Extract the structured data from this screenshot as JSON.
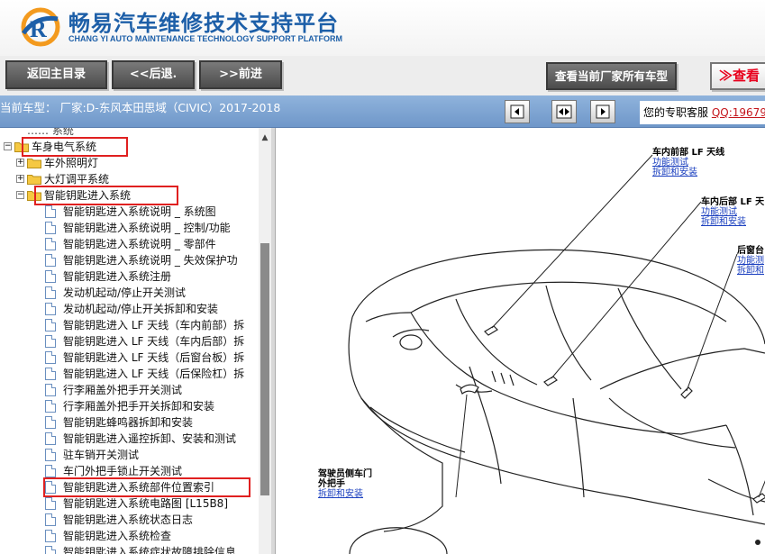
{
  "header": {
    "title": "畅易汽车维修技术支持平台",
    "subtitle": "CHANG YI AUTO MAINTENANCE TECHNOLOGY SUPPORT PLATFORM"
  },
  "toolbar": {
    "home_label": "返回主目录",
    "back_label": "<<后退.",
    "forward_label": ">>前进",
    "all_models_label": "查看当前厂家所有车型",
    "view_label": "≫查看"
  },
  "infobar": {
    "current_model": "当前车型：  厂家:D-东风本田思域（CIVIC）2017-2018",
    "support_text": "您的专职客服",
    "support_link": "QQ:19679"
  },
  "tree": {
    "top_partial": "…… 系统",
    "items": [
      {
        "label": "车身电气系统",
        "level": 0,
        "kind": "folder",
        "expanded": true,
        "highlight": true
      },
      {
        "label": "车外照明灯",
        "level": 1,
        "kind": "folder",
        "expanded": false
      },
      {
        "label": "大灯调平系统",
        "level": 1,
        "kind": "folder",
        "expanded": false
      },
      {
        "label": "智能钥匙进入系统",
        "level": 1,
        "kind": "folder",
        "expanded": true,
        "highlight": true
      },
      {
        "label": "智能钥匙进入系统说明 _ 系统图",
        "level": 2,
        "kind": "doc"
      },
      {
        "label": "智能钥匙进入系统说明 _ 控制/功能",
        "level": 2,
        "kind": "doc"
      },
      {
        "label": "智能钥匙进入系统说明 _ 零部件",
        "level": 2,
        "kind": "doc"
      },
      {
        "label": "智能钥匙进入系统说明 _ 失效保护功",
        "level": 2,
        "kind": "doc"
      },
      {
        "label": "智能钥匙进入系统注册",
        "level": 2,
        "kind": "doc"
      },
      {
        "label": "发动机起动/停止开关测试",
        "level": 2,
        "kind": "doc"
      },
      {
        "label": "发动机起动/停止开关拆卸和安装",
        "level": 2,
        "kind": "doc"
      },
      {
        "label": "智能钥匙进入 LF 天线（车内前部）拆",
        "level": 2,
        "kind": "doc"
      },
      {
        "label": "智能钥匙进入 LF 天线（车内后部）拆",
        "level": 2,
        "kind": "doc"
      },
      {
        "label": "智能钥匙进入 LF 天线（后窗台板）拆",
        "level": 2,
        "kind": "doc"
      },
      {
        "label": "智能钥匙进入 LF 天线（后保险杠）拆",
        "level": 2,
        "kind": "doc"
      },
      {
        "label": "行李厢盖外把手开关测试",
        "level": 2,
        "kind": "doc"
      },
      {
        "label": "行李厢盖外把手开关拆卸和安装",
        "level": 2,
        "kind": "doc"
      },
      {
        "label": "智能钥匙蜂鸣器拆卸和安装",
        "level": 2,
        "kind": "doc"
      },
      {
        "label": "智能钥匙进入遥控拆卸、安装和测试",
        "level": 2,
        "kind": "doc"
      },
      {
        "label": "驻车销开关测试",
        "level": 2,
        "kind": "doc"
      },
      {
        "label": "车门外把手锁止开关测试",
        "level": 2,
        "kind": "doc"
      },
      {
        "label": "智能钥匙进入系统部件位置索引",
        "level": 2,
        "kind": "doc",
        "highlight": true
      },
      {
        "label": "智能钥匙进入系统电路图 [L15B8]",
        "level": 2,
        "kind": "doc"
      },
      {
        "label": "智能钥匙进入系统状态日志",
        "level": 2,
        "kind": "doc"
      },
      {
        "label": "智能钥匙进入系统检查",
        "level": 2,
        "kind": "doc"
      },
      {
        "label": "智能钥匙进入系统症状故障排除信息",
        "level": 2,
        "kind": "doc"
      }
    ]
  },
  "diagram": {
    "callouts": [
      {
        "title": "车内前部 LF 天线",
        "links": [
          "功能测试",
          "拆卸和安装"
        ]
      },
      {
        "title": "车内后部 LF 天",
        "links": [
          "功能测试",
          "拆卸和安装"
        ]
      },
      {
        "title": "后窗台",
        "links": [
          "功能测",
          "拆卸和"
        ]
      },
      {
        "title": "驾驶员侧车门",
        "title2": "外把手",
        "links": [
          "拆卸和安装"
        ]
      }
    ]
  },
  "colors": {
    "brand_blue": "#1d5fa8",
    "infobar_blue": "#7ea4d3",
    "highlight_red": "#e02020",
    "link_blue": "#1a3fbf"
  }
}
